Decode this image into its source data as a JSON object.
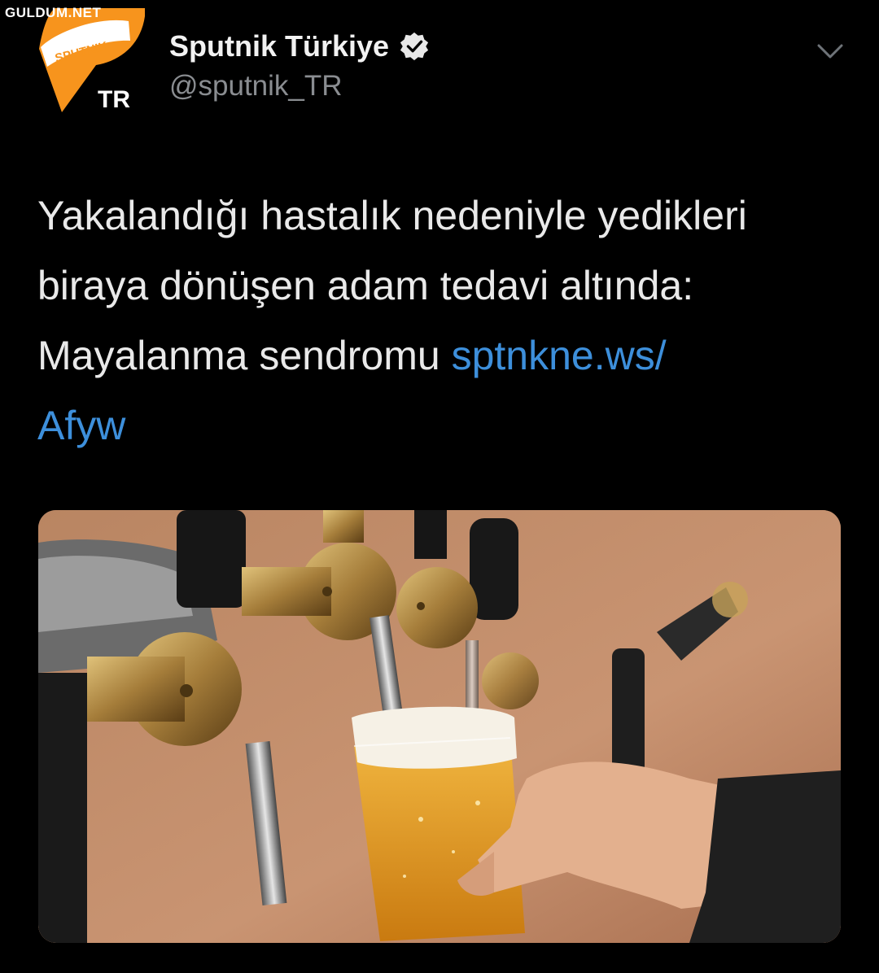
{
  "watermark": "GULDUM.NET",
  "author": {
    "avatar": {
      "brand_text": "SPUTNIK",
      "region_text": "TR",
      "color": "#f7941d"
    },
    "display_name": "Sputnik Türkiye",
    "handle": "@sputnik_TR",
    "verified": true
  },
  "tweet": {
    "text_line1": "Yakalandığı hastalık nedeniyle yedikleri",
    "text_line2": "biraya dönüşen adam tedavi altında:",
    "text_line3": "Mayalanma sendromu ",
    "link_part1": "sptnkne.ws/",
    "link_part2": "Afyw",
    "link_color": "#3d8fdb"
  },
  "icons": {
    "verified": "verified-badge-icon",
    "more": "chevron-down-icon"
  },
  "media": {
    "description_only": false
  }
}
